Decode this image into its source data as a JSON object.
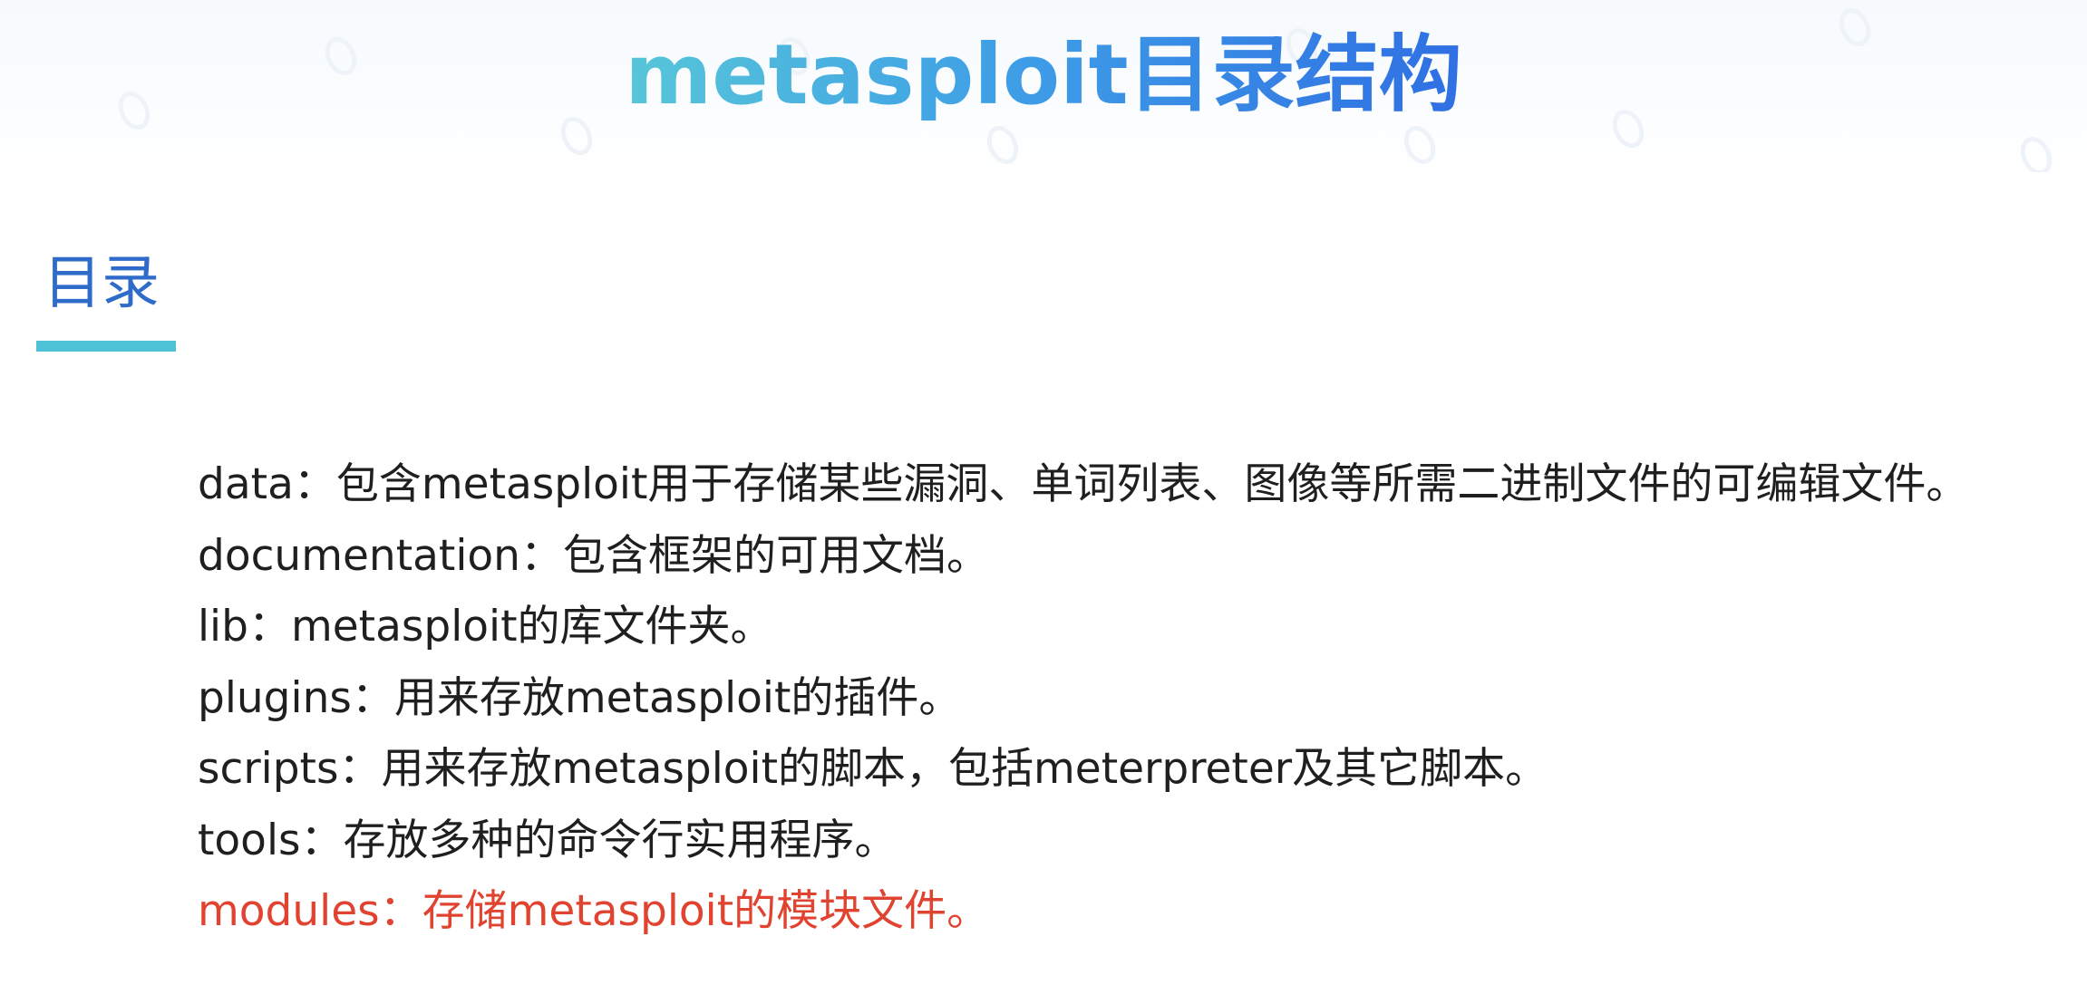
{
  "title": "metasploit目录结构",
  "section_heading": "目录",
  "items": [
    {
      "text": "data：包含metasploit用于存储某些漏洞、单词列表、图像等所需二进制文件的可编辑文件。"
    },
    {
      "text": "documentation：包含框架的可用文档。"
    },
    {
      "text": "lib：metasploit的库文件夹。"
    },
    {
      "text": "plugins：用来存放metasploit的插件。"
    },
    {
      "text": "scripts：用来存放metasploit的脚本，包括meterpreter及其它脚本。"
    },
    {
      "text": "tools：存放多种的命令行实用程序。"
    },
    {
      "text": "modules：存储metasploit的模块文件。"
    }
  ],
  "colors": {
    "title_gradient_start": "#57c6d8",
    "title_gradient_end": "#2f6fe3",
    "heading": "#2f6bc8",
    "underline": "#4ec2d6",
    "body_text": "#1f1f1f",
    "highlight_text": "#e0432f"
  }
}
